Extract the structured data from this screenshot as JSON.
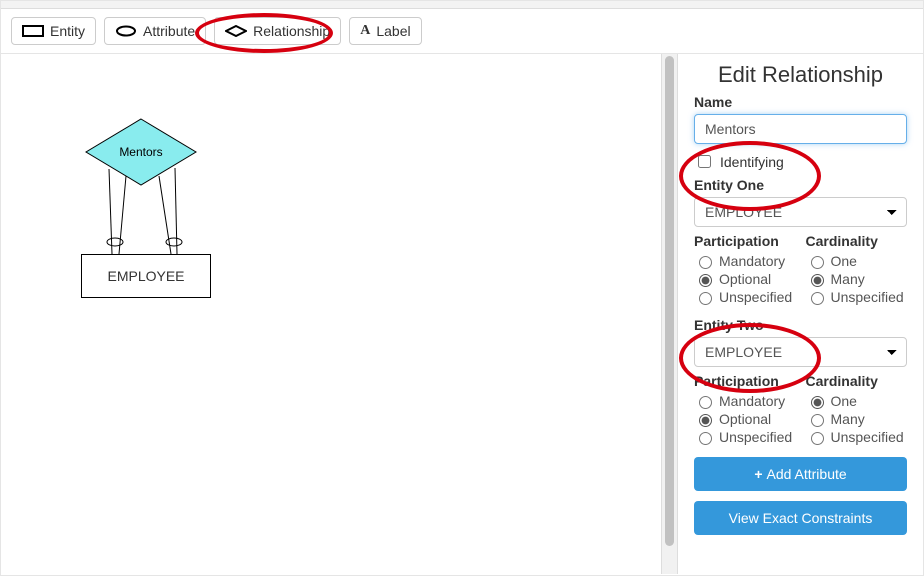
{
  "toolbar": {
    "entity_label": "Entity",
    "attribute_label": "Attribute",
    "relationship_label": "Relationship",
    "label_label": "Label"
  },
  "canvas": {
    "relationship_text": "Mentors",
    "entity_text": "EMPLOYEE"
  },
  "panel": {
    "title": "Edit Relationship",
    "name_label": "Name",
    "name_value": "Mentors",
    "identifying_label": "Identifying",
    "identifying_checked": false,
    "entity_one_label": "Entity One",
    "entity_one_value": "EMPLOYEE",
    "entity_two_label": "Entity Two",
    "entity_two_value": "EMPLOYEE",
    "participation_label": "Participation",
    "cardinality_label": "Cardinality",
    "part_options": {
      "mandatory": "Mandatory",
      "optional": "Optional",
      "unspecified": "Unspecified"
    },
    "card_options": {
      "one": "One",
      "many": "Many",
      "unspecified": "Unspecified"
    },
    "e1_participation": "Optional",
    "e1_cardinality": "Many",
    "e2_participation": "Optional",
    "e2_cardinality": "One",
    "add_attribute_label": "Add Attribute",
    "view_constraints_label": "View Exact Constraints"
  }
}
